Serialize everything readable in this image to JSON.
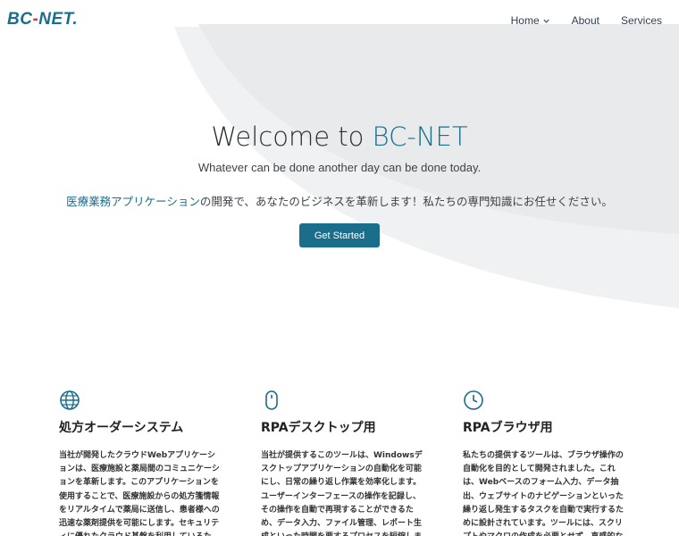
{
  "header": {
    "logo": {
      "part1": "BC",
      "dash": "-",
      "part2": "NET",
      "dot": "."
    },
    "nav": [
      {
        "label": "Home"
      },
      {
        "label": "About"
      },
      {
        "label": "Services"
      }
    ]
  },
  "hero": {
    "title_prefix": "Welcome to ",
    "title_brand": "BC-NET",
    "subtitle": "Whatever can be done another day can be done today.",
    "jp_highlight": "医療業務アプリケーション",
    "jp_rest": "の開発で、あなたのビジネスを革新します！私たちの専門知識にお任せください。",
    "cta_label": "Get Started"
  },
  "features": [
    {
      "icon": "globe-icon",
      "title": "処方オーダーシステム",
      "desc": "当社が開発したクラウドWebアプリケーションは、医療施設と薬局間のコミュニケーションを革新します。このアプリケーションを使用することで、医療施設からの処方箋情報をリアルタイムで薬局に送信し、患者様への迅速な薬剤提供を可能にします。セキュリティに優れたクラウド基盤を利用しているため、どのようなデバ"
    },
    {
      "icon": "mouse-icon",
      "title": "RPAデスクトップ用",
      "desc": "当社が提供するこのツールは、Windowsデスクトップアプリケーションの自動化を可能にし、日常の繰り返し作業を効率化します。ユーザーインターフェースの操作を記録し、その操作を自動で再現することができるため、データ入力、ファイル管理、レポート生成といった時間を要するプロセスを短縮します。この自動化"
    },
    {
      "icon": "clock-icon",
      "title": "RPAブラウザ用",
      "desc": "私たちの提供するツールは、ブラウザ操作の自動化を目的として開発されました。これは、Webベースのフォーム入力、データ抽出、ウェブサイトのナビゲーションといった繰り返し発生するタスクを自動で実行するために設計されています。ツールには、スクリプトやマクロの作成を必要とせず、直感的なポイント＆クリッ"
    }
  ],
  "colors": {
    "brand": "#1a6e8c",
    "accent": "#e2324a",
    "text": "#222222"
  }
}
